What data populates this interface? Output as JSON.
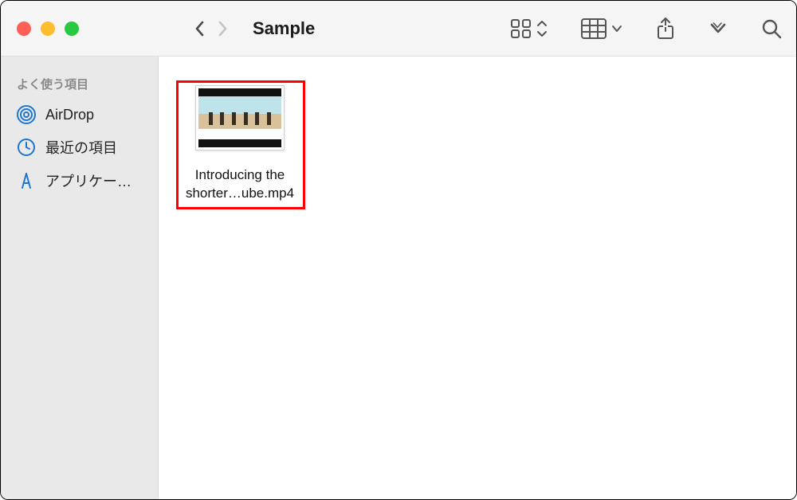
{
  "window": {
    "title": "Sample"
  },
  "sidebar": {
    "heading": "よく使う項目",
    "items": [
      {
        "label": "AirDrop"
      },
      {
        "label": "最近の項目"
      },
      {
        "label": "アプリケー…"
      }
    ]
  },
  "content": {
    "files": [
      {
        "label_line1": "Introducing the",
        "label_line2": "shorter…ube.mp4"
      }
    ]
  },
  "colors": {
    "highlight": "#ff0000",
    "accent": "#1e76d2"
  }
}
